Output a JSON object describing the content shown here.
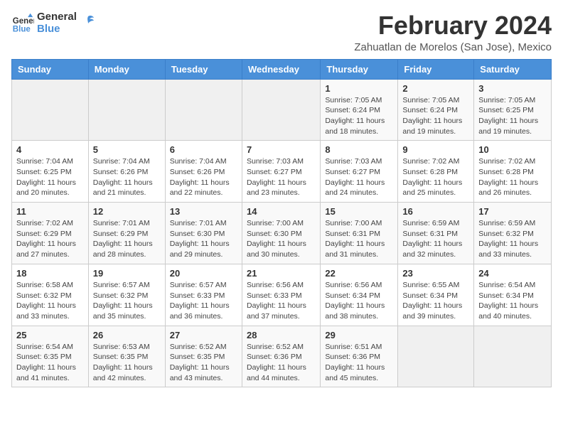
{
  "logo": {
    "line1": "General",
    "line2": "Blue"
  },
  "title": "February 2024",
  "subtitle": "Zahuatlan de Morelos (San Jose), Mexico",
  "header_color": "#4a90d9",
  "weekdays": [
    "Sunday",
    "Monday",
    "Tuesday",
    "Wednesday",
    "Thursday",
    "Friday",
    "Saturday"
  ],
  "weeks": [
    [
      {
        "day": "",
        "info": ""
      },
      {
        "day": "",
        "info": ""
      },
      {
        "day": "",
        "info": ""
      },
      {
        "day": "",
        "info": ""
      },
      {
        "day": "1",
        "info": "Sunrise: 7:05 AM\nSunset: 6:24 PM\nDaylight: 11 hours\nand 18 minutes."
      },
      {
        "day": "2",
        "info": "Sunrise: 7:05 AM\nSunset: 6:24 PM\nDaylight: 11 hours\nand 19 minutes."
      },
      {
        "day": "3",
        "info": "Sunrise: 7:05 AM\nSunset: 6:25 PM\nDaylight: 11 hours\nand 19 minutes."
      }
    ],
    [
      {
        "day": "4",
        "info": "Sunrise: 7:04 AM\nSunset: 6:25 PM\nDaylight: 11 hours\nand 20 minutes."
      },
      {
        "day": "5",
        "info": "Sunrise: 7:04 AM\nSunset: 6:26 PM\nDaylight: 11 hours\nand 21 minutes."
      },
      {
        "day": "6",
        "info": "Sunrise: 7:04 AM\nSunset: 6:26 PM\nDaylight: 11 hours\nand 22 minutes."
      },
      {
        "day": "7",
        "info": "Sunrise: 7:03 AM\nSunset: 6:27 PM\nDaylight: 11 hours\nand 23 minutes."
      },
      {
        "day": "8",
        "info": "Sunrise: 7:03 AM\nSunset: 6:27 PM\nDaylight: 11 hours\nand 24 minutes."
      },
      {
        "day": "9",
        "info": "Sunrise: 7:02 AM\nSunset: 6:28 PM\nDaylight: 11 hours\nand 25 minutes."
      },
      {
        "day": "10",
        "info": "Sunrise: 7:02 AM\nSunset: 6:28 PM\nDaylight: 11 hours\nand 26 minutes."
      }
    ],
    [
      {
        "day": "11",
        "info": "Sunrise: 7:02 AM\nSunset: 6:29 PM\nDaylight: 11 hours\nand 27 minutes."
      },
      {
        "day": "12",
        "info": "Sunrise: 7:01 AM\nSunset: 6:29 PM\nDaylight: 11 hours\nand 28 minutes."
      },
      {
        "day": "13",
        "info": "Sunrise: 7:01 AM\nSunset: 6:30 PM\nDaylight: 11 hours\nand 29 minutes."
      },
      {
        "day": "14",
        "info": "Sunrise: 7:00 AM\nSunset: 6:30 PM\nDaylight: 11 hours\nand 30 minutes."
      },
      {
        "day": "15",
        "info": "Sunrise: 7:00 AM\nSunset: 6:31 PM\nDaylight: 11 hours\nand 31 minutes."
      },
      {
        "day": "16",
        "info": "Sunrise: 6:59 AM\nSunset: 6:31 PM\nDaylight: 11 hours\nand 32 minutes."
      },
      {
        "day": "17",
        "info": "Sunrise: 6:59 AM\nSunset: 6:32 PM\nDaylight: 11 hours\nand 33 minutes."
      }
    ],
    [
      {
        "day": "18",
        "info": "Sunrise: 6:58 AM\nSunset: 6:32 PM\nDaylight: 11 hours\nand 33 minutes."
      },
      {
        "day": "19",
        "info": "Sunrise: 6:57 AM\nSunset: 6:32 PM\nDaylight: 11 hours\nand 35 minutes."
      },
      {
        "day": "20",
        "info": "Sunrise: 6:57 AM\nSunset: 6:33 PM\nDaylight: 11 hours\nand 36 minutes."
      },
      {
        "day": "21",
        "info": "Sunrise: 6:56 AM\nSunset: 6:33 PM\nDaylight: 11 hours\nand 37 minutes."
      },
      {
        "day": "22",
        "info": "Sunrise: 6:56 AM\nSunset: 6:34 PM\nDaylight: 11 hours\nand 38 minutes."
      },
      {
        "day": "23",
        "info": "Sunrise: 6:55 AM\nSunset: 6:34 PM\nDaylight: 11 hours\nand 39 minutes."
      },
      {
        "day": "24",
        "info": "Sunrise: 6:54 AM\nSunset: 6:34 PM\nDaylight: 11 hours\nand 40 minutes."
      }
    ],
    [
      {
        "day": "25",
        "info": "Sunrise: 6:54 AM\nSunset: 6:35 PM\nDaylight: 11 hours\nand 41 minutes."
      },
      {
        "day": "26",
        "info": "Sunrise: 6:53 AM\nSunset: 6:35 PM\nDaylight: 11 hours\nand 42 minutes."
      },
      {
        "day": "27",
        "info": "Sunrise: 6:52 AM\nSunset: 6:35 PM\nDaylight: 11 hours\nand 43 minutes."
      },
      {
        "day": "28",
        "info": "Sunrise: 6:52 AM\nSunset: 6:36 PM\nDaylight: 11 hours\nand 44 minutes."
      },
      {
        "day": "29",
        "info": "Sunrise: 6:51 AM\nSunset: 6:36 PM\nDaylight: 11 hours\nand 45 minutes."
      },
      {
        "day": "",
        "info": ""
      },
      {
        "day": "",
        "info": ""
      }
    ]
  ]
}
